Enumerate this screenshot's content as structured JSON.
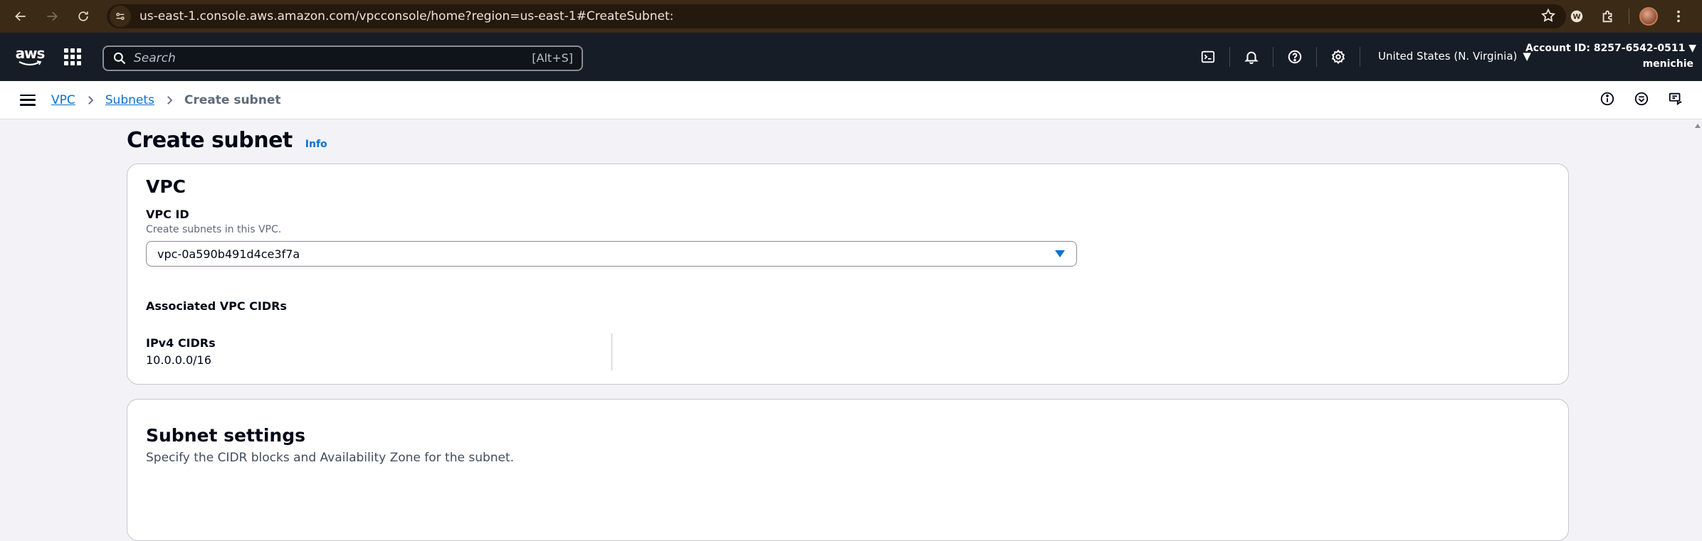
{
  "browser": {
    "url": "us-east-1.console.aws.amazon.com/vpcconsole/home?region=us-east-1#CreateSubnet:"
  },
  "aws_nav": {
    "logo_text": "aws",
    "search_placeholder": "Search",
    "search_shortcut": "[Alt+S]",
    "region": "United States (N. Virginia)",
    "account_id": "Account ID: 8257-6542-0511",
    "username": "menichie"
  },
  "breadcrumb": {
    "items": [
      "VPC",
      "Subnets"
    ],
    "current": "Create subnet"
  },
  "page": {
    "title": "Create subnet",
    "info_label": "Info"
  },
  "vpc_section": {
    "heading": "VPC",
    "vpc_id_label": "VPC ID",
    "vpc_id_description": "Create subnets in this VPC.",
    "vpc_id_value": "vpc-0a590b491d4ce3f7a",
    "associated_cidrs_label": "Associated VPC CIDRs",
    "ipv4_label": "IPv4 CIDRs",
    "ipv4_value": "10.0.0.0/16"
  },
  "subnet_section": {
    "heading": "Subnet settings",
    "description": "Specify the CIDR blocks and Availability Zone for the subnet."
  },
  "colors": {
    "link": "#0972d3",
    "nav_bg": "#161d26",
    "browser_bg": "#3b2a16",
    "page_bg": "#f3f3f7"
  }
}
